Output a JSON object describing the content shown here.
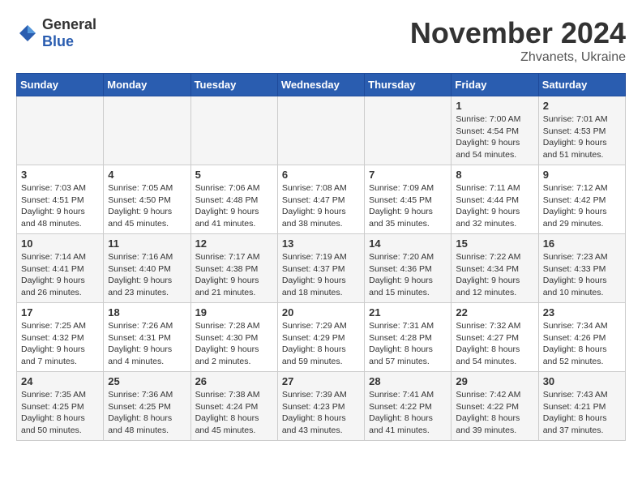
{
  "header": {
    "logo_general": "General",
    "logo_blue": "Blue",
    "month_title": "November 2024",
    "location": "Zhvanets, Ukraine"
  },
  "days_of_week": [
    "Sunday",
    "Monday",
    "Tuesday",
    "Wednesday",
    "Thursday",
    "Friday",
    "Saturday"
  ],
  "weeks": [
    [
      {
        "day": "",
        "content": ""
      },
      {
        "day": "",
        "content": ""
      },
      {
        "day": "",
        "content": ""
      },
      {
        "day": "",
        "content": ""
      },
      {
        "day": "",
        "content": ""
      },
      {
        "day": "1",
        "content": "Sunrise: 7:00 AM\nSunset: 4:54 PM\nDaylight: 9 hours and 54 minutes."
      },
      {
        "day": "2",
        "content": "Sunrise: 7:01 AM\nSunset: 4:53 PM\nDaylight: 9 hours and 51 minutes."
      }
    ],
    [
      {
        "day": "3",
        "content": "Sunrise: 7:03 AM\nSunset: 4:51 PM\nDaylight: 9 hours and 48 minutes."
      },
      {
        "day": "4",
        "content": "Sunrise: 7:05 AM\nSunset: 4:50 PM\nDaylight: 9 hours and 45 minutes."
      },
      {
        "day": "5",
        "content": "Sunrise: 7:06 AM\nSunset: 4:48 PM\nDaylight: 9 hours and 41 minutes."
      },
      {
        "day": "6",
        "content": "Sunrise: 7:08 AM\nSunset: 4:47 PM\nDaylight: 9 hours and 38 minutes."
      },
      {
        "day": "7",
        "content": "Sunrise: 7:09 AM\nSunset: 4:45 PM\nDaylight: 9 hours and 35 minutes."
      },
      {
        "day": "8",
        "content": "Sunrise: 7:11 AM\nSunset: 4:44 PM\nDaylight: 9 hours and 32 minutes."
      },
      {
        "day": "9",
        "content": "Sunrise: 7:12 AM\nSunset: 4:42 PM\nDaylight: 9 hours and 29 minutes."
      }
    ],
    [
      {
        "day": "10",
        "content": "Sunrise: 7:14 AM\nSunset: 4:41 PM\nDaylight: 9 hours and 26 minutes."
      },
      {
        "day": "11",
        "content": "Sunrise: 7:16 AM\nSunset: 4:40 PM\nDaylight: 9 hours and 23 minutes."
      },
      {
        "day": "12",
        "content": "Sunrise: 7:17 AM\nSunset: 4:38 PM\nDaylight: 9 hours and 21 minutes."
      },
      {
        "day": "13",
        "content": "Sunrise: 7:19 AM\nSunset: 4:37 PM\nDaylight: 9 hours and 18 minutes."
      },
      {
        "day": "14",
        "content": "Sunrise: 7:20 AM\nSunset: 4:36 PM\nDaylight: 9 hours and 15 minutes."
      },
      {
        "day": "15",
        "content": "Sunrise: 7:22 AM\nSunset: 4:34 PM\nDaylight: 9 hours and 12 minutes."
      },
      {
        "day": "16",
        "content": "Sunrise: 7:23 AM\nSunset: 4:33 PM\nDaylight: 9 hours and 10 minutes."
      }
    ],
    [
      {
        "day": "17",
        "content": "Sunrise: 7:25 AM\nSunset: 4:32 PM\nDaylight: 9 hours and 7 minutes."
      },
      {
        "day": "18",
        "content": "Sunrise: 7:26 AM\nSunset: 4:31 PM\nDaylight: 9 hours and 4 minutes."
      },
      {
        "day": "19",
        "content": "Sunrise: 7:28 AM\nSunset: 4:30 PM\nDaylight: 9 hours and 2 minutes."
      },
      {
        "day": "20",
        "content": "Sunrise: 7:29 AM\nSunset: 4:29 PM\nDaylight: 8 hours and 59 minutes."
      },
      {
        "day": "21",
        "content": "Sunrise: 7:31 AM\nSunset: 4:28 PM\nDaylight: 8 hours and 57 minutes."
      },
      {
        "day": "22",
        "content": "Sunrise: 7:32 AM\nSunset: 4:27 PM\nDaylight: 8 hours and 54 minutes."
      },
      {
        "day": "23",
        "content": "Sunrise: 7:34 AM\nSunset: 4:26 PM\nDaylight: 8 hours and 52 minutes."
      }
    ],
    [
      {
        "day": "24",
        "content": "Sunrise: 7:35 AM\nSunset: 4:25 PM\nDaylight: 8 hours and 50 minutes."
      },
      {
        "day": "25",
        "content": "Sunrise: 7:36 AM\nSunset: 4:25 PM\nDaylight: 8 hours and 48 minutes."
      },
      {
        "day": "26",
        "content": "Sunrise: 7:38 AM\nSunset: 4:24 PM\nDaylight: 8 hours and 45 minutes."
      },
      {
        "day": "27",
        "content": "Sunrise: 7:39 AM\nSunset: 4:23 PM\nDaylight: 8 hours and 43 minutes."
      },
      {
        "day": "28",
        "content": "Sunrise: 7:41 AM\nSunset: 4:22 PM\nDaylight: 8 hours and 41 minutes."
      },
      {
        "day": "29",
        "content": "Sunrise: 7:42 AM\nSunset: 4:22 PM\nDaylight: 8 hours and 39 minutes."
      },
      {
        "day": "30",
        "content": "Sunrise: 7:43 AM\nSunset: 4:21 PM\nDaylight: 8 hours and 37 minutes."
      }
    ]
  ]
}
